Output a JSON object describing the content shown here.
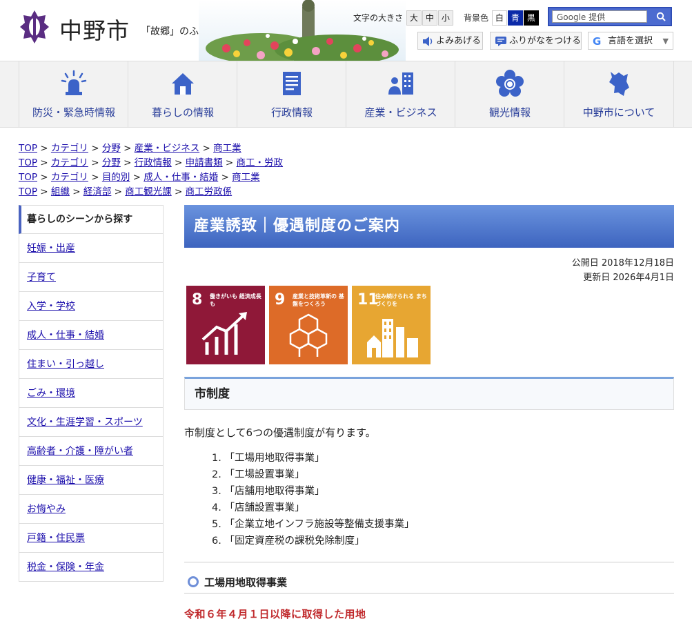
{
  "header": {
    "logo_text": "中野市",
    "tagline": "「故郷」のふるさと",
    "font_size_label": "文字の大きさ",
    "size_large": "大",
    "size_medium": "中",
    "size_small": "小",
    "bg_color_label": "背景色",
    "bg_white": "白",
    "bg_blue": "青",
    "bg_black": "黒",
    "search_placeholder": "Google 提供",
    "read_aloud": "よみあげる",
    "furigana": "ふりがなをつける",
    "language_select": "言語を選択"
  },
  "gnav": [
    {
      "label": "防災・緊急時情報",
      "icon": "siren-icon"
    },
    {
      "label": "暮らしの情報",
      "icon": "house-icon"
    },
    {
      "label": "行政情報",
      "icon": "document-icon"
    },
    {
      "label": "産業・ビジネス",
      "icon": "business-icon"
    },
    {
      "label": "観光情報",
      "icon": "flower-icon"
    },
    {
      "label": "中野市について",
      "icon": "map-icon"
    }
  ],
  "breadcrumbs": [
    [
      "TOP",
      "カテゴリ",
      "分野",
      "産業・ビジネス",
      "商工業"
    ],
    [
      "TOP",
      "カテゴリ",
      "分野",
      "行政情報",
      "申請書類",
      "商工・労政"
    ],
    [
      "TOP",
      "カテゴリ",
      "目的別",
      "成人・仕事・結婚",
      "商工業"
    ],
    [
      "TOP",
      "組織",
      "経済部",
      "商工観光課",
      "商工労政係"
    ]
  ],
  "sidebar": {
    "heading": "暮らしのシーンから探す",
    "items": [
      "妊娠・出産",
      "子育て",
      "入学・学校",
      "成人・仕事・結婚",
      "住まい・引っ越し",
      "ごみ・環境",
      "文化・生涯学習・スポーツ",
      "高齢者・介護・障がい者",
      "健康・福祉・医療",
      "お悔やみ",
      "戸籍・住民票",
      "税金・保険・年金"
    ]
  },
  "main": {
    "title": "産業誘致｜優遇制度のご案内",
    "published": "公開日 2018年12月18日",
    "updated": "更新日 2026年4月1日",
    "sdgs": [
      {
        "num": "8",
        "text": "働きがいも 経済成長も",
        "color": "#8f1838"
      },
      {
        "num": "9",
        "text": "産業と技術革新の 基盤をつくろう",
        "color": "#dd6b28"
      },
      {
        "num": "11",
        "text": "住み続けられる まちづくりを",
        "color": "#e7a632"
      }
    ],
    "section_heading": "市制度",
    "intro": "市制度として6つの優遇制度が有ります。",
    "list": [
      "「工場用地取得事業」",
      "「工場設置事業」",
      "「店舗用地取得事業」",
      "「店舗設置事業」",
      "「企業立地インフラ施設等整備支援事業」",
      "「固定資産税の課税免除制度」"
    ],
    "subheading": "工場用地取得事業",
    "red_heading": "令和６年４月１日以降に取得した用地"
  }
}
